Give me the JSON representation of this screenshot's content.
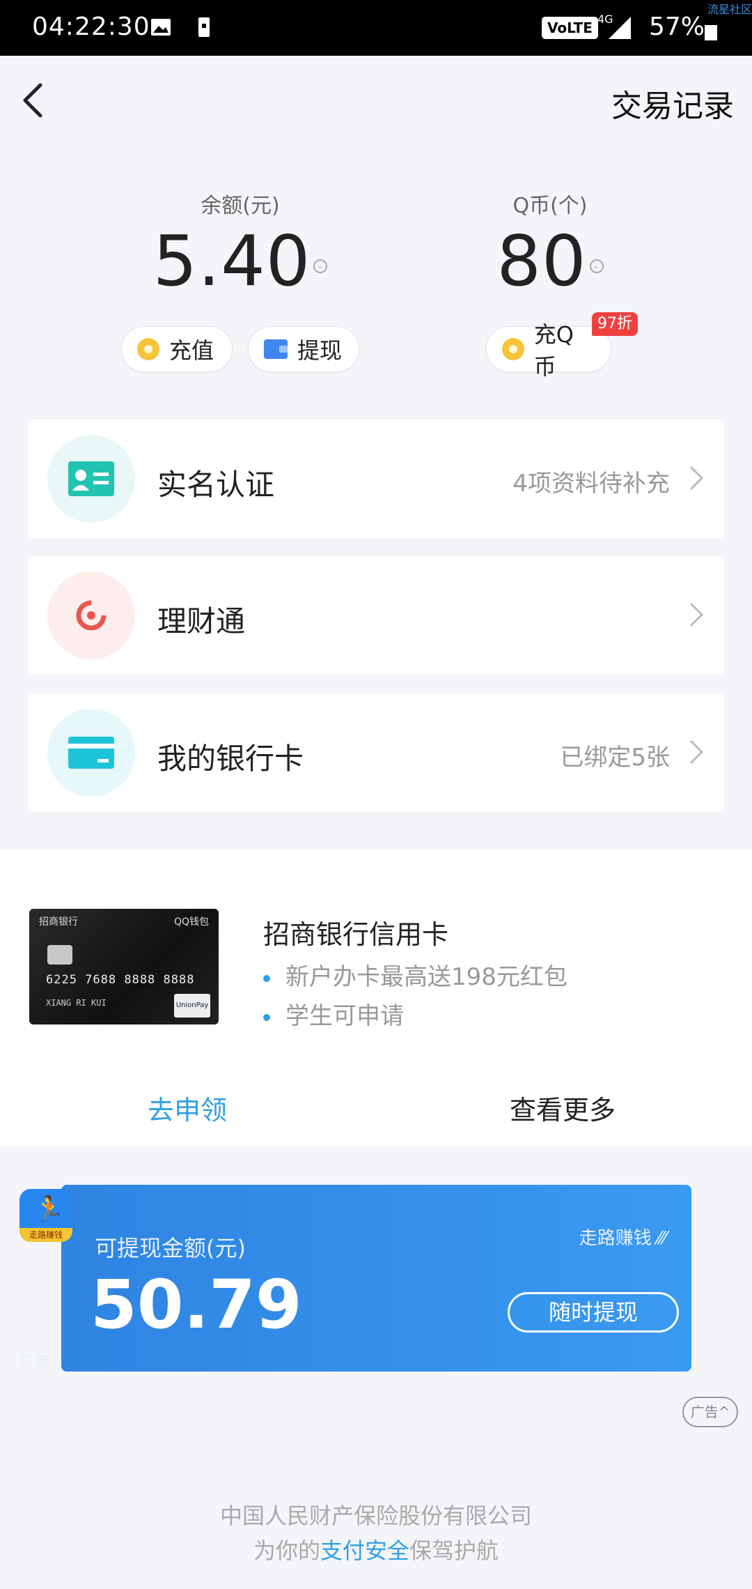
{
  "status_bar": {
    "time": "04:22:30",
    "volte": "VoLTE",
    "network": "4G",
    "battery": "57%",
    "watermark": "流星社区"
  },
  "header": {
    "back_icon": "chevron-left-icon",
    "right_action": "交易记录"
  },
  "balance": {
    "label": "余额(元)",
    "value": "5.40",
    "recharge_label": "充值",
    "withdraw_label": "提现"
  },
  "qcoin": {
    "label": "Q币(个)",
    "value": "80",
    "recharge_label": "充Q币",
    "discount_badge": "97折"
  },
  "menu": [
    {
      "title": "实名认证",
      "subtitle": "4项资料待补充",
      "icon": "id-card-icon",
      "color": "#22c3b0",
      "bg": "#e9f8f7"
    },
    {
      "title": "理财通",
      "subtitle": "",
      "icon": "finance-icon",
      "color": "#e8584f",
      "bg": "#fdeeed"
    },
    {
      "title": "我的银行卡",
      "subtitle": "已绑定5张",
      "icon": "bank-card-icon",
      "color": "#1fc3d6",
      "bg": "#e7f8fa"
    }
  ],
  "promo": {
    "title": "招商银行信用卡",
    "bullets": [
      "新户办卡最高送198元红包",
      "学生可申请"
    ],
    "apply_label": "去申领",
    "more_label": "查看更多",
    "card_image": {
      "bank": "招商银行",
      "wallet": "QQ钱包",
      "number": "6225 7688 8888 8888",
      "holder": "XIANG RI KUI",
      "network": "UnionPay"
    }
  },
  "ad": {
    "amount_label": "可提现金额(元)",
    "amount": "50.79",
    "tagline": "走路赚钱 ⁄⁄⁄",
    "button_label": "随时提现",
    "app_icon_tag": "走路赚钱",
    "side_label": "广告",
    "toggle_label": "广告^"
  },
  "footer": {
    "line1": "中国人民财产保险股份有限公司",
    "line2_prefix": "为你的",
    "line2_highlight": "支付安全",
    "line2_suffix": "保驾护航"
  },
  "colors": {
    "accent": "#2fa0e6",
    "badge_red": "#f04141",
    "ad_blue": "#2f84e2"
  }
}
